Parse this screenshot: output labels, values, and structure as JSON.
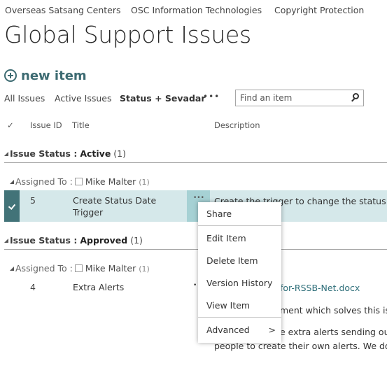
{
  "top_nav": [
    "Overseas Satsang Centers",
    "OSC Information Technologies",
    "Copyright Protection"
  ],
  "page_title": "Global Support Issues",
  "new_item_label": "new item",
  "views": [
    "All Issues",
    "Active Issues",
    "Status + Sevadar"
  ],
  "views_more": "•••",
  "search": {
    "placeholder": "Find an item"
  },
  "columns": {
    "check": "✓",
    "id": "Issue ID",
    "title": "Title",
    "description": "Description"
  },
  "groups": [
    {
      "label": "Issue Status :",
      "value": "Active",
      "count": "(1)",
      "subgroup": {
        "label": "Assigned To :",
        "name": "Mike Malter",
        "count": "(1)"
      },
      "row": {
        "id": "5",
        "title_line1": "Create Status Date",
        "title_line2": "Trigger",
        "ellipsis": "•••",
        "description": "Create the trigger to change the status date"
      }
    },
    {
      "label": "Issue Status :",
      "value": "Approved",
      "count": "(1)",
      "subgroup": {
        "label": "Assigned To :",
        "name": "Mike Malter",
        "count": "(1)"
      },
      "row": {
        "id": "4",
        "title": "Extra Alerts",
        "bullet": "•",
        "attachment": "for-RSSB-Net.docx",
        "desc_line1": "ment which solves this issue",
        "desc_line2": "e extra alerts sending out d",
        "desc_line3": "people to create their own alerts.  We do se"
      }
    }
  ],
  "context_menu": {
    "items": [
      "Share",
      "Edit Item",
      "Delete Item",
      "Version History",
      "View Item",
      "Advanced"
    ],
    "submenu_arrow": ">"
  }
}
